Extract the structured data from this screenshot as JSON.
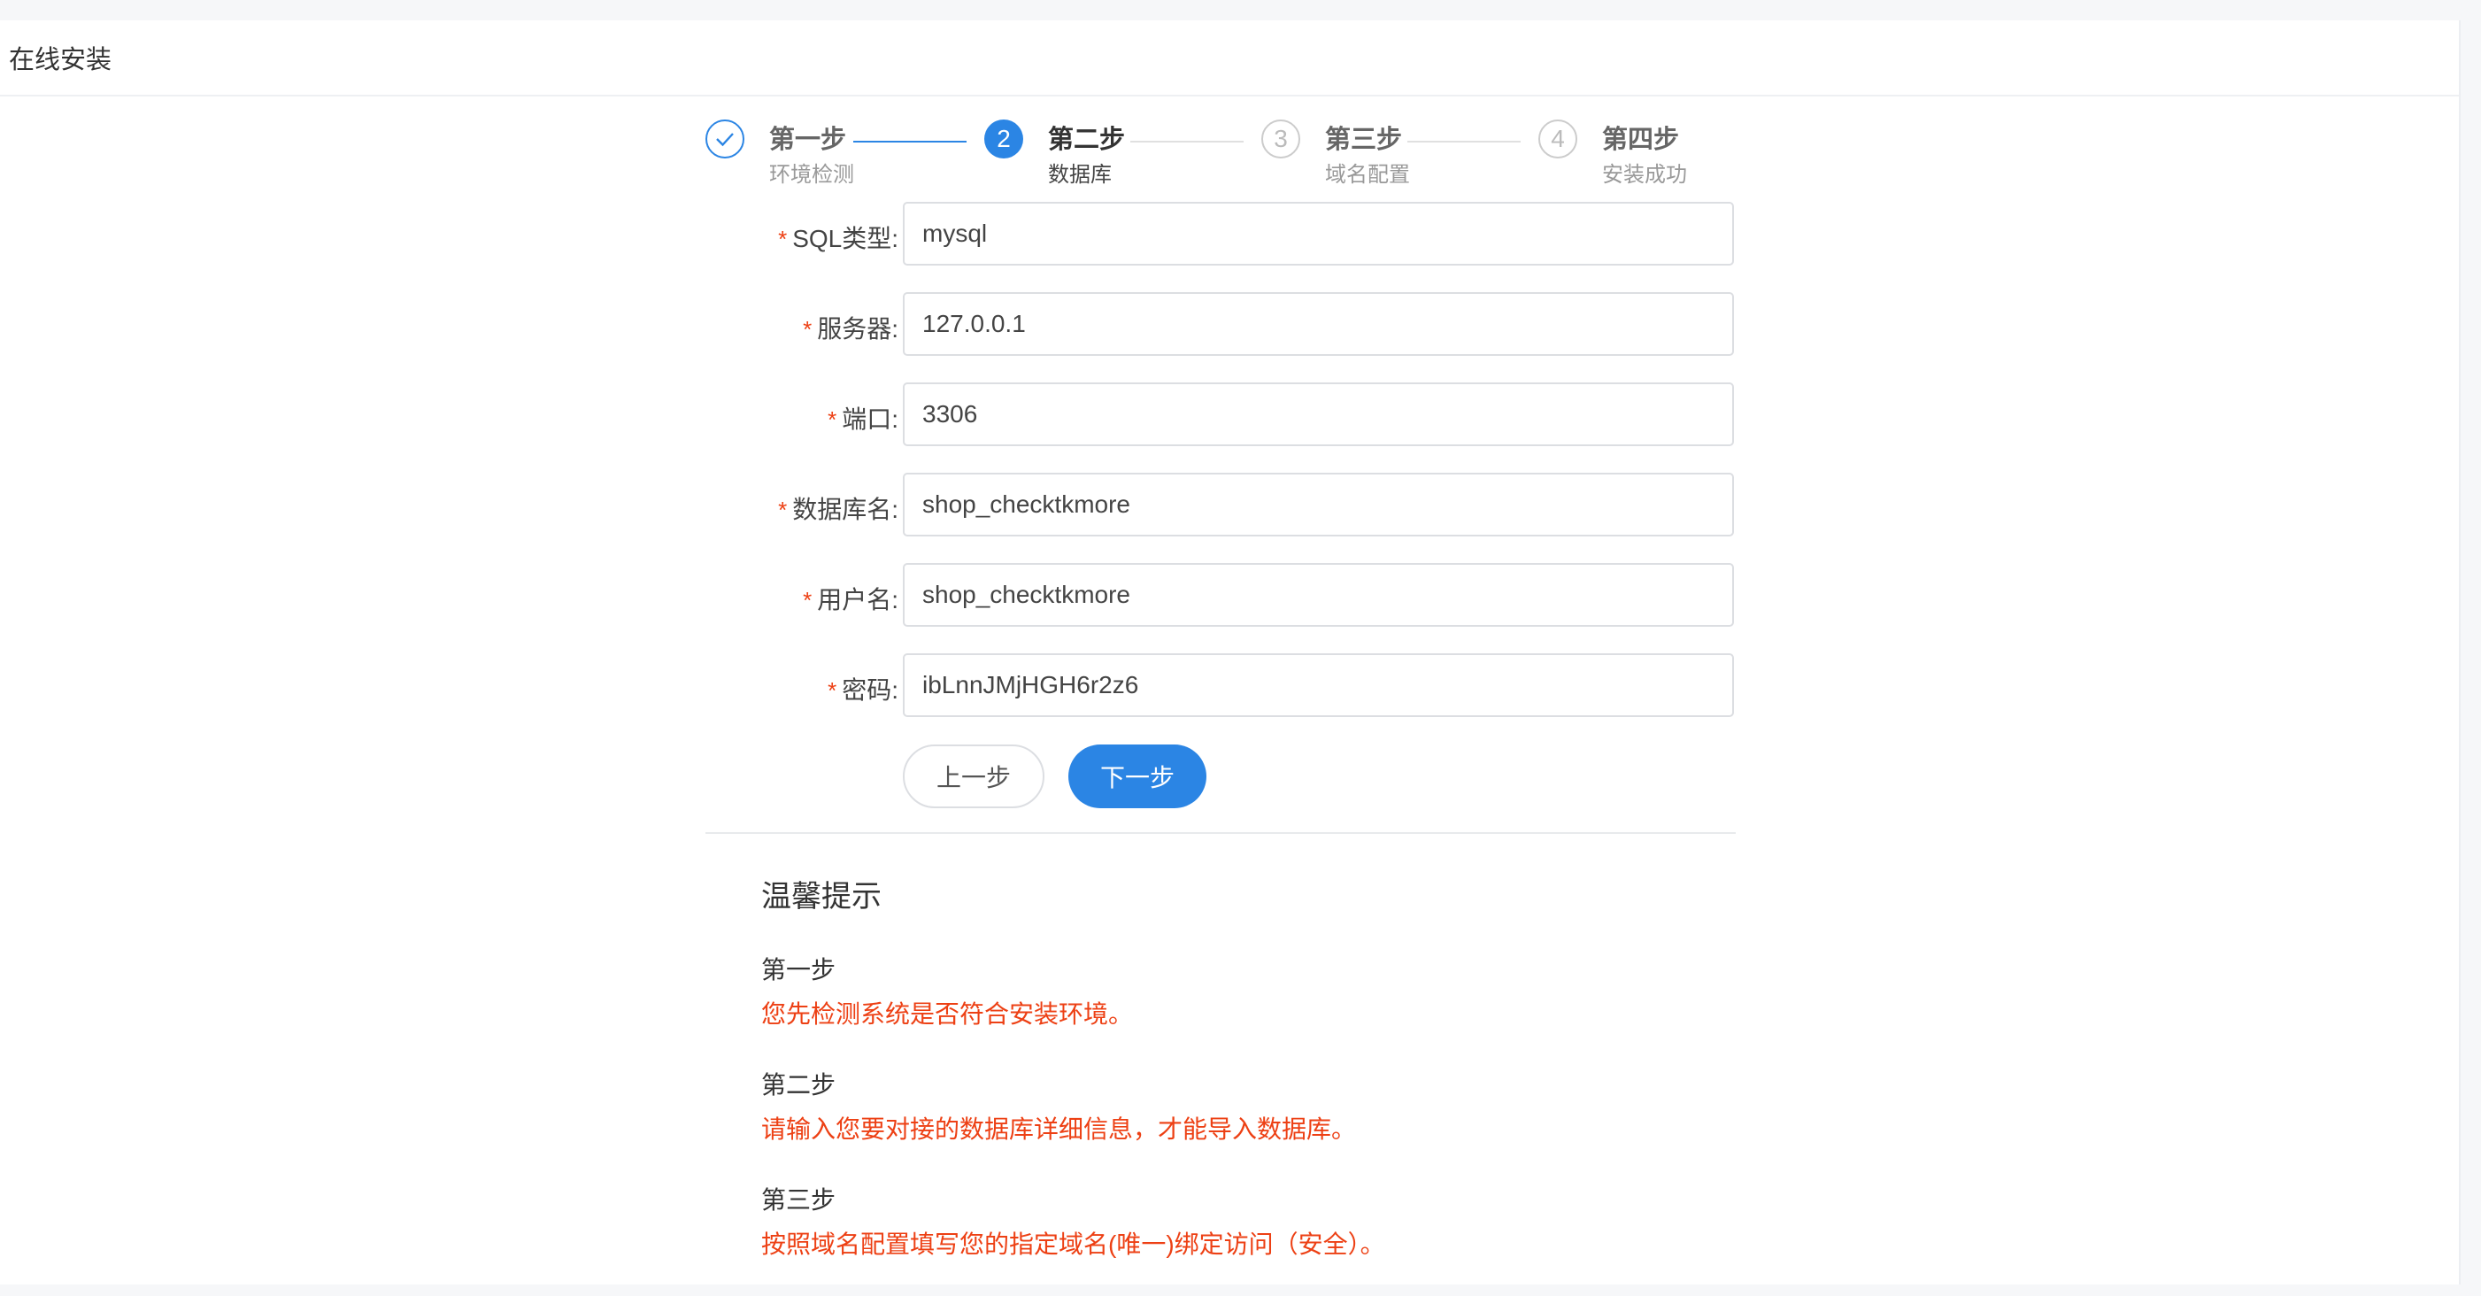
{
  "header": {
    "title": "在线安装"
  },
  "steps": [
    {
      "title": "第一步",
      "desc": "环境检测",
      "status": "done",
      "marker": "check-icon"
    },
    {
      "title": "第二步",
      "desc": "数据库",
      "status": "active",
      "number": "2"
    },
    {
      "title": "第三步",
      "desc": "域名配置",
      "status": "wait",
      "number": "3"
    },
    {
      "title": "第四步",
      "desc": "安装成功",
      "status": "wait",
      "number": "4"
    }
  ],
  "form": {
    "required_mark": "*",
    "fields": [
      {
        "label": "SQL类型:",
        "value": "mysql"
      },
      {
        "label": "服务器:",
        "value": "127.0.0.1"
      },
      {
        "label": "端口:",
        "value": "3306"
      },
      {
        "label": "数据库名:",
        "value": "shop_checktkmore"
      },
      {
        "label": "用户名:",
        "value": "shop_checktkmore"
      },
      {
        "label": "密码:",
        "value": "ibLnnJMjHGH6r2z6"
      }
    ],
    "prev_label": "上一步",
    "next_label": "下一步"
  },
  "tips": {
    "title": "温馨提示",
    "items": [
      {
        "step": "第一步",
        "text": "您先检测系统是否符合安装环境。"
      },
      {
        "step": "第二步",
        "text": "请输入您要对接的数据库详细信息，才能导入数据库。"
      },
      {
        "step": "第三步",
        "text": "按照域名配置填写您的指定域名(唯一)绑定访问（安全）。"
      }
    ]
  },
  "colors": {
    "primary": "#2b85e4",
    "required": "#ed4014",
    "tip_text": "#ed4014"
  }
}
